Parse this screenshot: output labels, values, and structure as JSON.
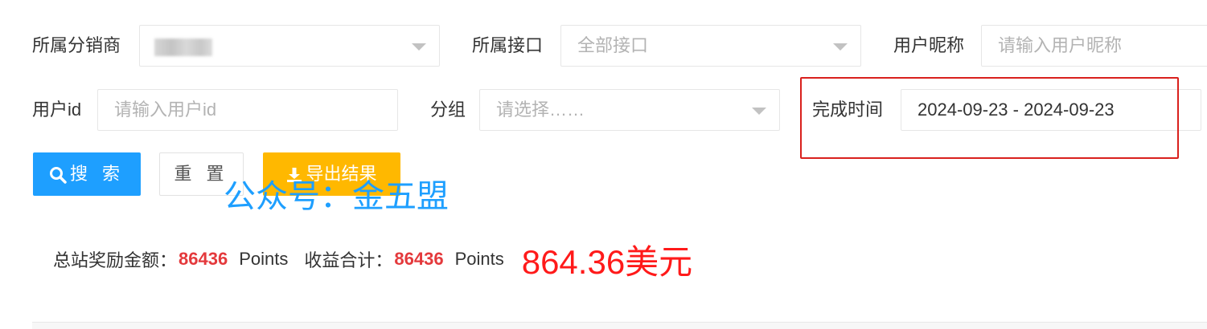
{
  "filters": {
    "distributor_label": "所属分销商",
    "interface_label": "所属接口",
    "interface_value": "全部接口",
    "nickname_label": "用户昵称",
    "nickname_placeholder": "请输入用户昵称",
    "userid_label": "用户id",
    "userid_placeholder": "请输入用户id",
    "group_label": "分组",
    "group_placeholder": "请选择……",
    "time_label": "完成时间",
    "time_value": "2024-09-23 - 2024-09-23"
  },
  "buttons": {
    "search": "搜 索",
    "reset": "重 置",
    "export": "导出结果"
  },
  "watermark": "公众号：金五盟",
  "summary": {
    "total_label": "总站奖励金额：",
    "total_value": "86436",
    "total_unit": "Points",
    "income_label": "收益合计：",
    "income_value": "86436",
    "income_unit": "Points",
    "usd_note": "864.36美元"
  },
  "colors": {
    "primary": "#1E9FFF",
    "warn": "#FFB800",
    "highlight": "#d9201d",
    "amount": "#e4393c"
  },
  "icons": {
    "search": "search-icon",
    "download": "download-icon"
  }
}
